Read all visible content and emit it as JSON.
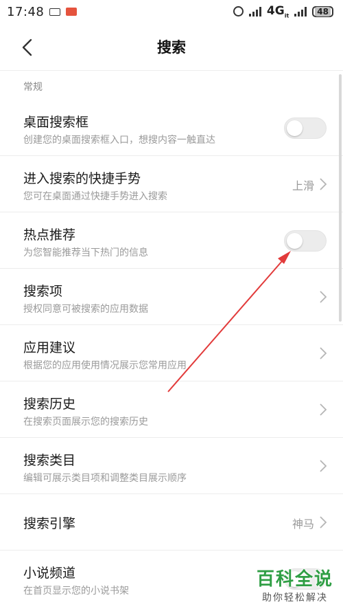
{
  "status_bar": {
    "time": "17:48",
    "network": "4G",
    "network_sub": "it",
    "battery": "48"
  },
  "header": {
    "title": "搜索"
  },
  "section": {
    "label": "常规"
  },
  "items": [
    {
      "title": "桌面搜索框",
      "subtitle": "创建您的桌面搜索框入口，想搜内容一触直达",
      "control": "toggle",
      "enabled": false
    },
    {
      "title": "进入搜索的快捷手势",
      "subtitle": "您可在桌面通过快捷手势进入搜索",
      "control": "value",
      "value": "上滑"
    },
    {
      "title": "热点推荐",
      "subtitle": "为您智能推荐当下热门的信息",
      "control": "toggle",
      "enabled": false
    },
    {
      "title": "搜索项",
      "subtitle": "授权同意可被搜索的应用数据",
      "control": "chevron"
    },
    {
      "title": "应用建议",
      "subtitle": "根据您的应用使用情况展示您常用应用",
      "control": "chevron"
    },
    {
      "title": "搜索历史",
      "subtitle": "在搜索页面展示您的搜索历史",
      "control": "chevron"
    },
    {
      "title": "搜索类目",
      "subtitle": "编辑可展示类目项和调整类目展示顺序",
      "control": "chevron"
    },
    {
      "title": "搜索引擎",
      "subtitle": "",
      "control": "value",
      "value": "神马"
    },
    {
      "title": "小说频道",
      "subtitle": "在首页显示您的小说书架",
      "control": "toggle",
      "enabled": false
    }
  ],
  "watermark": {
    "main": "百科全说",
    "sub": "助你轻松解决"
  },
  "colors": {
    "annotation_arrow": "#e23b3b",
    "toggle_off": "#ececec",
    "watermark": "#2f9e44"
  }
}
